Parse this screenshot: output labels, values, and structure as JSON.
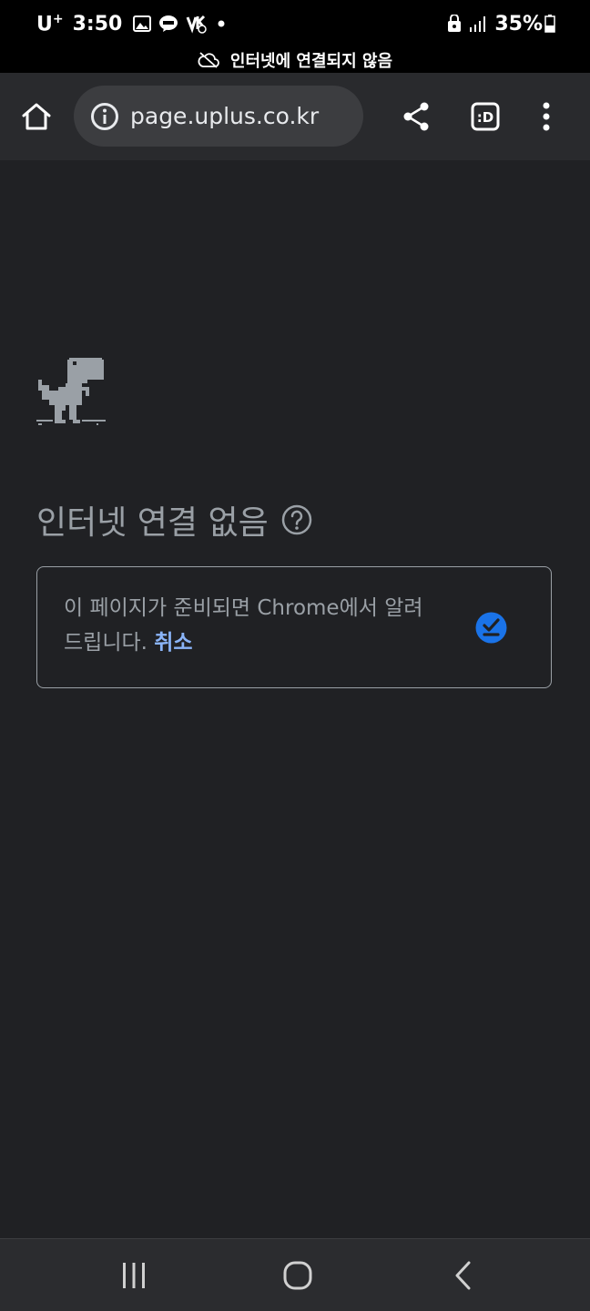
{
  "status_bar": {
    "carrier": "U",
    "carrier_plus": "+",
    "time": "3:50",
    "battery": "35%",
    "icons": [
      "gallery-icon",
      "talk-icon",
      "vpn-icon",
      "dot-icon",
      "lock-icon",
      "signal-icon",
      "battery-icon"
    ]
  },
  "offline_banner": {
    "text": "인터넷에 연결되지 않음",
    "icon": "cloud-off-icon"
  },
  "toolbar": {
    "url": "page.uplus.co.kr",
    "tab_icon_label": ":D"
  },
  "content": {
    "title": "인터넷 연결 없음",
    "notify_message": "이 페이지가 준비되면 Chrome에서 알려드립니다.",
    "cancel_label": "취소"
  },
  "colors": {
    "background": "#202124",
    "toolbar": "#292a2d",
    "url_bar": "#3c3d40",
    "text_secondary": "#9aa0a6",
    "link": "#8ab4f8",
    "check_accent": "#1a73e8"
  }
}
